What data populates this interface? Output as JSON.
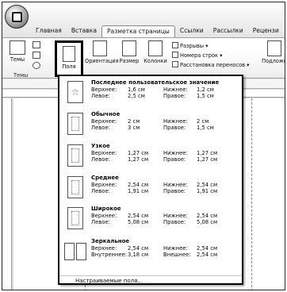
{
  "ribbon": {
    "tabs": [
      "Главная",
      "Вставка",
      "Разметка страницы",
      "Ссылки",
      "Рассылки",
      "Рецензи"
    ],
    "active_tab_index": 2,
    "themes_label": "Темы",
    "group_themes_label": "Темы",
    "fields_label": "Поля",
    "orientation_label": "Ориентация",
    "size_label": "Размер",
    "columns_label": "Колонки",
    "breaks_label": "Разрывы ▾",
    "line_numbers_label": "Номера строк ▾",
    "hyphenation_label": "Расстановка переносов ▾",
    "watermark_label": "Подложк"
  },
  "dropdown": {
    "presets": [
      {
        "name": "Последнее пользовательское значение",
        "top_label": "Верхнее:",
        "top": "1,6 см",
        "bottom_label": "Нижнее:",
        "bottom": "1,2 см",
        "left_label": "Левое:",
        "left": "2,5 см",
        "right_label": "Правое:",
        "right": "1,5 см",
        "icon": "star-page-icon"
      },
      {
        "name": "Обычное",
        "top_label": "Верхнее:",
        "top": "2 см",
        "bottom_label": "Нижнее:",
        "bottom": "2 см",
        "left_label": "Левое:",
        "left": "3 см",
        "right_label": "Правое:",
        "right": "1,5 см",
        "icon": "page-icon"
      },
      {
        "name": "Узкое",
        "top_label": "Верхнее:",
        "top": "1,27 см",
        "bottom_label": "Нижнее:",
        "bottom": "1,27 см",
        "left_label": "Левое:",
        "left": "1,27 см",
        "right_label": "Правое:",
        "right": "1,27 см",
        "icon": "page-icon"
      },
      {
        "name": "Среднее",
        "top_label": "Верхнее:",
        "top": "2,54 см",
        "bottom_label": "Нижнее:",
        "bottom": "2,54 см",
        "left_label": "Левое:",
        "left": "1,91 см",
        "right_label": "Правое:",
        "right": "1,91 см",
        "icon": "page-icon"
      },
      {
        "name": "Широкое",
        "top_label": "Верхнее:",
        "top": "2,54 см",
        "bottom_label": "Нижнее:",
        "bottom": "2,54 см",
        "left_label": "Левое:",
        "left": "5,08 см",
        "right_label": "Правое:",
        "right": "5,08 см",
        "icon": "page-icon"
      },
      {
        "name": "Зеркальное",
        "top_label": "Верхнее:",
        "top": "2,54 см",
        "bottom_label": "Нижнее:",
        "bottom": "2,54 см",
        "left_label": "Внутреннее:",
        "left": "3,18 см",
        "right_label": "Внешнее:",
        "right": "2,54 см",
        "icon": "mirror-pages-icon"
      }
    ],
    "custom_label": "Настраиваемые поля..."
  }
}
